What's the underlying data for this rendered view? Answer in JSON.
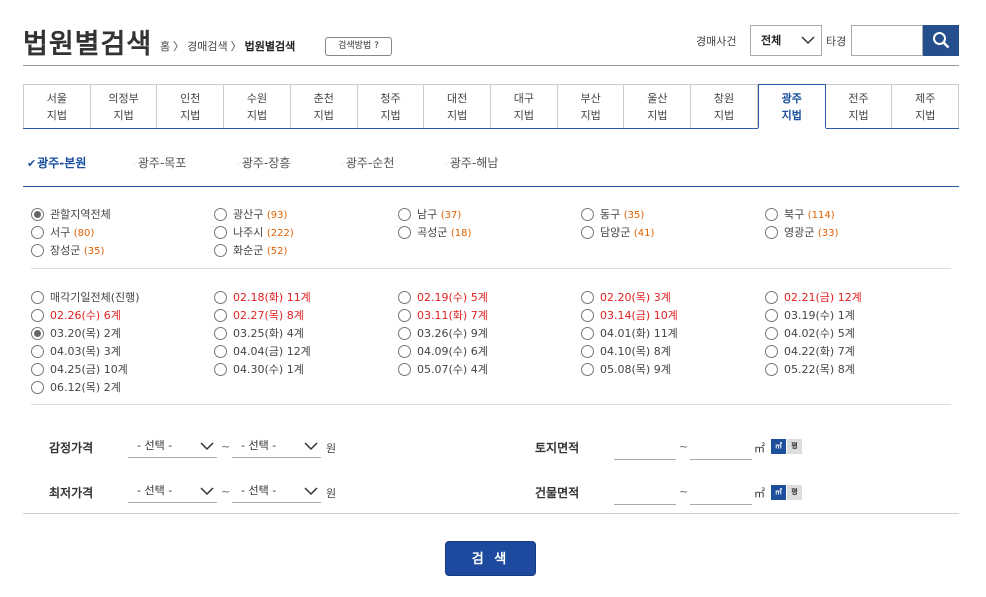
{
  "header": {
    "title": "법원별검색",
    "breadcrumb": [
      "홈",
      "경매검색",
      "법원별검색"
    ],
    "help_label": "검색방법 ?",
    "case_label": "경매사건",
    "case_select": "전체",
    "other_label": "타경",
    "search_value": ""
  },
  "courts": [
    {
      "l1": "서울",
      "l2": "지법"
    },
    {
      "l1": "의정부",
      "l2": "지법"
    },
    {
      "l1": "인천",
      "l2": "지법"
    },
    {
      "l1": "수원",
      "l2": "지법"
    },
    {
      "l1": "춘천",
      "l2": "지법"
    },
    {
      "l1": "청주",
      "l2": "지법"
    },
    {
      "l1": "대전",
      "l2": "지법"
    },
    {
      "l1": "대구",
      "l2": "지법"
    },
    {
      "l1": "부산",
      "l2": "지법"
    },
    {
      "l1": "울산",
      "l2": "지법"
    },
    {
      "l1": "창원",
      "l2": "지법"
    },
    {
      "l1": "광주",
      "l2": "지법"
    },
    {
      "l1": "전주",
      "l2": "지법"
    },
    {
      "l1": "제주",
      "l2": "지법"
    }
  ],
  "active_court_index": 11,
  "branches": [
    "광주-본원",
    "광주-목포",
    "광주-장흥",
    "광주-순천",
    "광주-해남"
  ],
  "regions": [
    {
      "name": "관할지역전체",
      "count": "",
      "checked": true
    },
    {
      "name": "광산구",
      "count": "(93)"
    },
    {
      "name": "남구",
      "count": "(37)"
    },
    {
      "name": "동구",
      "count": "(35)"
    },
    {
      "name": "북구",
      "count": "(114)"
    },
    {
      "name": "서구",
      "count": "(80)"
    },
    {
      "name": "나주시",
      "count": "(222)"
    },
    {
      "name": "곡성군",
      "count": "(18)"
    },
    {
      "name": "담양군",
      "count": "(41)"
    },
    {
      "name": "영광군",
      "count": "(33)"
    },
    {
      "name": "장성군",
      "count": "(35)"
    },
    {
      "name": "화순군",
      "count": "(52)"
    }
  ],
  "dates": [
    {
      "label": "매각기일전체(진행)",
      "red": false
    },
    {
      "label": "02.18(화) 11계",
      "red": true
    },
    {
      "label": "02.19(수) 5계",
      "red": true
    },
    {
      "label": "02.20(목) 3계",
      "red": true
    },
    {
      "label": "02.21(금) 12계",
      "red": true
    },
    {
      "label": "02.26(수) 6계",
      "red": true
    },
    {
      "label": "02.27(목) 8계",
      "red": true
    },
    {
      "label": "03.11(화) 7계",
      "red": true
    },
    {
      "label": "03.14(금) 10계",
      "red": true
    },
    {
      "label": "03.19(수) 1계",
      "red": false
    },
    {
      "label": "03.20(목) 2계",
      "red": false,
      "checked": true
    },
    {
      "label": "03.25(화) 4계",
      "red": false
    },
    {
      "label": "03.26(수) 9계",
      "red": false
    },
    {
      "label": "04.01(화) 11계",
      "red": false
    },
    {
      "label": "04.02(수) 5계",
      "red": false
    },
    {
      "label": "04.03(목) 3계",
      "red": false
    },
    {
      "label": "04.04(금) 12계",
      "red": false
    },
    {
      "label": "04.09(수) 6계",
      "red": false
    },
    {
      "label": "04.10(목) 8계",
      "red": false
    },
    {
      "label": "04.22(화) 7계",
      "red": false
    },
    {
      "label": "04.25(금) 10계",
      "red": false
    },
    {
      "label": "04.30(수) 1계",
      "red": false
    },
    {
      "label": "05.07(수) 4계",
      "red": false
    },
    {
      "label": "05.08(목) 9계",
      "red": false
    },
    {
      "label": "05.22(목) 8계",
      "red": false
    },
    {
      "label": "06.12(목) 2계",
      "red": false
    }
  ],
  "filters": {
    "appraisal_label": "감정가격",
    "min_price_label": "최저가격",
    "select_placeholder": "- 선택 -",
    "tilde": "~",
    "won": "원",
    "land_area_label": "토지면적",
    "building_area_label": "건물면적",
    "sqm": "㎡",
    "sqm_btn": "㎡",
    "pyeong_btn": "평"
  },
  "submit_label": "검 색",
  "colors": {
    "accent": "#1d4a9e",
    "red": "#e02020",
    "count": "#e06000"
  }
}
